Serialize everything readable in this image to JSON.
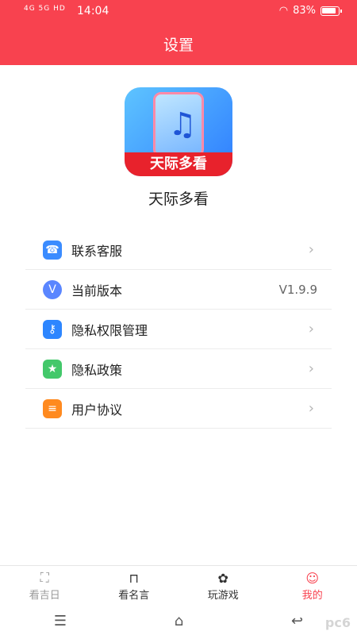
{
  "status": {
    "signal": "4G 5G HD",
    "time": "14:04",
    "battery": "83%"
  },
  "header": {
    "title": "设置"
  },
  "app": {
    "logo_text": "天际多看",
    "name": "天际多看"
  },
  "menu": [
    {
      "label": "联系客服",
      "icon": "headset-icon",
      "color": "#3b8cff",
      "value": ""
    },
    {
      "label": "当前版本",
      "icon": "version-icon",
      "color": "#5a86ff",
      "value": "V1.9.9"
    },
    {
      "label": "隐私权限管理",
      "icon": "key-icon",
      "color": "#2d86ff",
      "value": ""
    },
    {
      "label": "隐私政策",
      "icon": "bookmark-icon",
      "color": "#43c86a",
      "value": ""
    },
    {
      "label": "用户协议",
      "icon": "document-icon",
      "color": "#ff8a1f",
      "value": ""
    }
  ],
  "tabs": [
    {
      "label": "看吉日",
      "icon": "scan-icon"
    },
    {
      "label": "看名言",
      "icon": "basket-icon"
    },
    {
      "label": "玩游戏",
      "icon": "flower-icon"
    },
    {
      "label": "我的",
      "icon": "user-icon"
    }
  ],
  "watermark": "pc6"
}
